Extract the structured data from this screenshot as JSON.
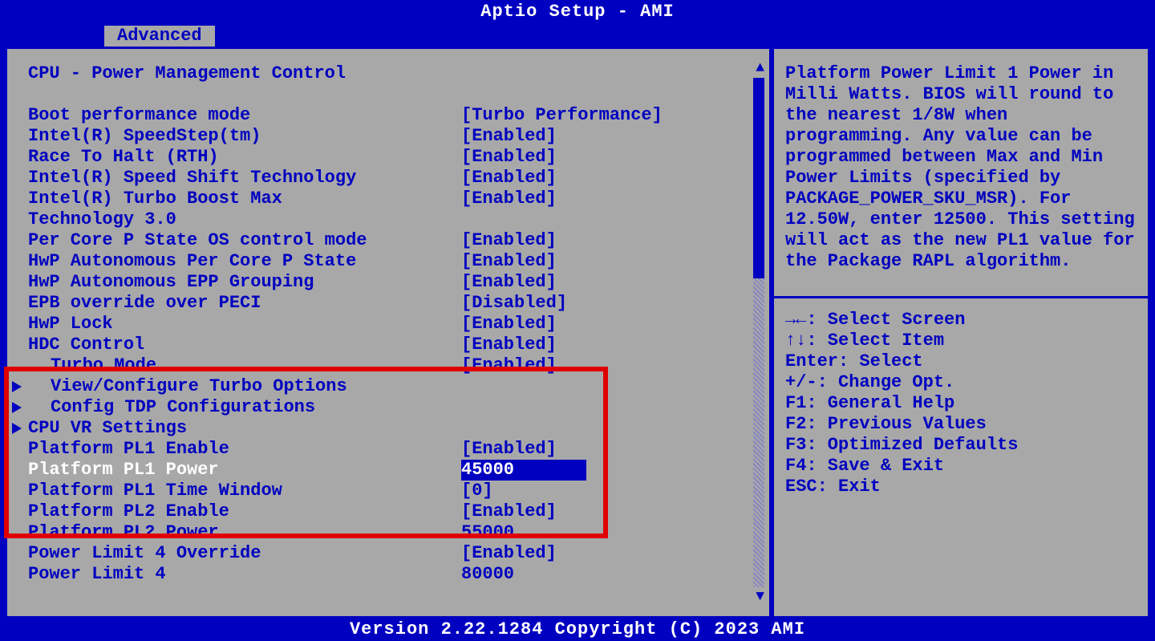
{
  "header": {
    "title": "Aptio Setup - AMI"
  },
  "tab": {
    "label": "Advanced"
  },
  "section": {
    "title": "CPU - Power Management Control"
  },
  "items": [
    {
      "label": "Boot performance mode",
      "value": "[Turbo Performance]"
    },
    {
      "label": "Intel(R) SpeedStep(tm)",
      "value": "[Enabled]"
    },
    {
      "label": "Race To Halt (RTH)",
      "value": "[Enabled]"
    },
    {
      "label": "Intel(R) Speed Shift Technology",
      "value": "[Enabled]"
    },
    {
      "label": "Intel(R) Turbo Boost Max",
      "value": "[Enabled]"
    },
    {
      "label": "Technology 3.0",
      "value": ""
    },
    {
      "label": "Per Core P State OS control mode",
      "value": "[Enabled]"
    },
    {
      "label": "HwP Autonomous Per Core P State",
      "value": "[Enabled]"
    },
    {
      "label": "HwP Autonomous EPP Grouping",
      "value": "[Enabled]"
    },
    {
      "label": "EPB override over PECI",
      "value": "[Disabled]"
    },
    {
      "label": "HwP Lock",
      "value": "[Enabled]"
    },
    {
      "label": "HDC Control",
      "value": "[Enabled]"
    },
    {
      "label": "Turbo Mode",
      "value": "[Enabled]"
    }
  ],
  "submenus": [
    {
      "label": "View/Configure Turbo Options"
    },
    {
      "label": "Config TDP Configurations"
    },
    {
      "label": "CPU VR Settings"
    }
  ],
  "pl": [
    {
      "label": "Platform PL1 Enable",
      "value": "[Enabled]"
    },
    {
      "label": "Platform PL1 Power",
      "value": "45000"
    },
    {
      "label": "Platform PL1 Time Window",
      "value": "[0]"
    },
    {
      "label": "Platform PL2 Enable",
      "value": "[Enabled]"
    },
    {
      "label": "Platform PL2 Power",
      "value": "55000"
    },
    {
      "label": "Power Limit 4 Override",
      "value": "[Enabled]"
    },
    {
      "label": "Power Limit 4",
      "value": "80000"
    }
  ],
  "help": {
    "text": "Platform Power Limit 1 Power in Milli Watts. BIOS will round to the nearest 1/8W when programming. Any value can be programmed between Max and Min Power Limits (specified by PACKAGE_POWER_SKU_MSR). For 12.50W, enter 12500. This setting will act as the new PL1 value for the Package RAPL algorithm."
  },
  "keys": [
    "→←: Select Screen",
    "↑↓: Select Item",
    "Enter: Select",
    "+/-: Change Opt.",
    "F1: General Help",
    "F2: Previous Values",
    "F3: Optimized Defaults",
    "F4: Save & Exit",
    "ESC: Exit"
  ],
  "footer": {
    "text": "Version 2.22.1284 Copyright (C) 2023 AMI"
  }
}
